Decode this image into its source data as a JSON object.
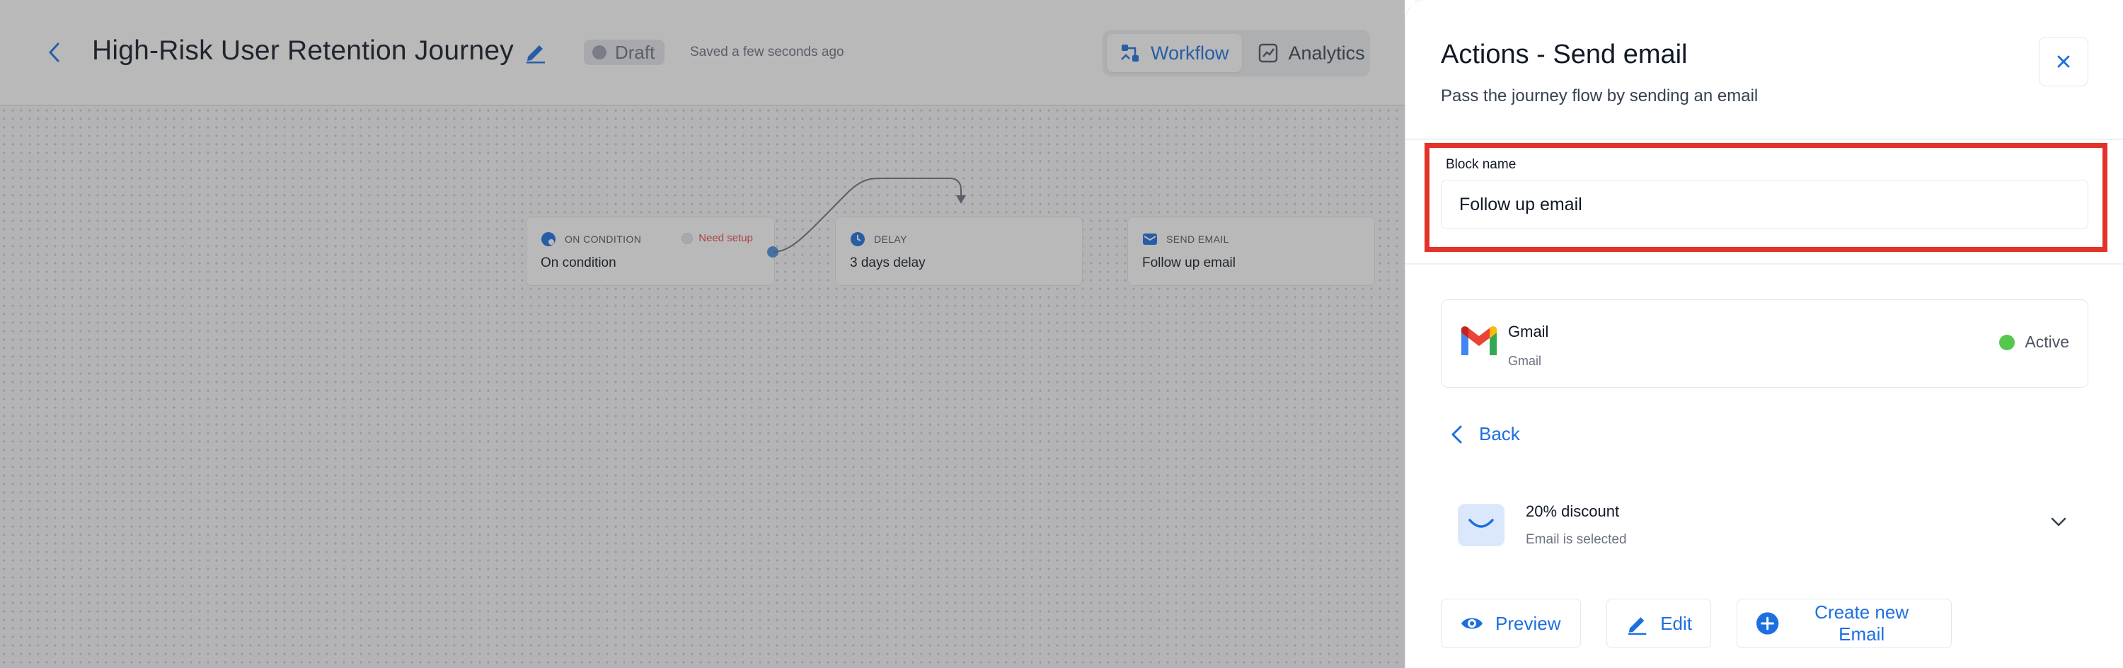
{
  "header": {
    "title": "High-Risk User Retention Journey",
    "status_badge": "Draft",
    "saved_text": "Saved a few seconds ago",
    "tabs": [
      {
        "label": "Workflow",
        "icon": "workflow-icon",
        "active": true
      },
      {
        "label": "Analytics",
        "icon": "analytics-icon",
        "active": false
      }
    ]
  },
  "canvas": {
    "nodes": [
      {
        "type": "ON CONDITION",
        "name": "On condition",
        "icon": "condition-icon",
        "warning": "Need setup"
      },
      {
        "type": "DELAY",
        "name": "3 days delay",
        "icon": "clock-icon"
      },
      {
        "type": "SEND EMAIL",
        "name": "Follow up email",
        "icon": "mail-icon"
      }
    ]
  },
  "drawer": {
    "title": "Actions - Send email",
    "subtitle": "Pass the journey flow by sending an email",
    "block_name_label": "Block name",
    "block_name_value": "Follow up email",
    "integration": {
      "name": "Gmail",
      "sub": "Gmail",
      "status": "Active"
    },
    "back_label": "Back",
    "email": {
      "title": "20% discount",
      "sub": "Email is selected"
    },
    "buttons": {
      "preview": "Preview",
      "edit": "Edit",
      "create": "Create new Email"
    }
  },
  "colors": {
    "accent": "#1d6fe0",
    "highlight": "#e3322a",
    "active_status": "#56c74d",
    "warning": "#e5484d"
  }
}
